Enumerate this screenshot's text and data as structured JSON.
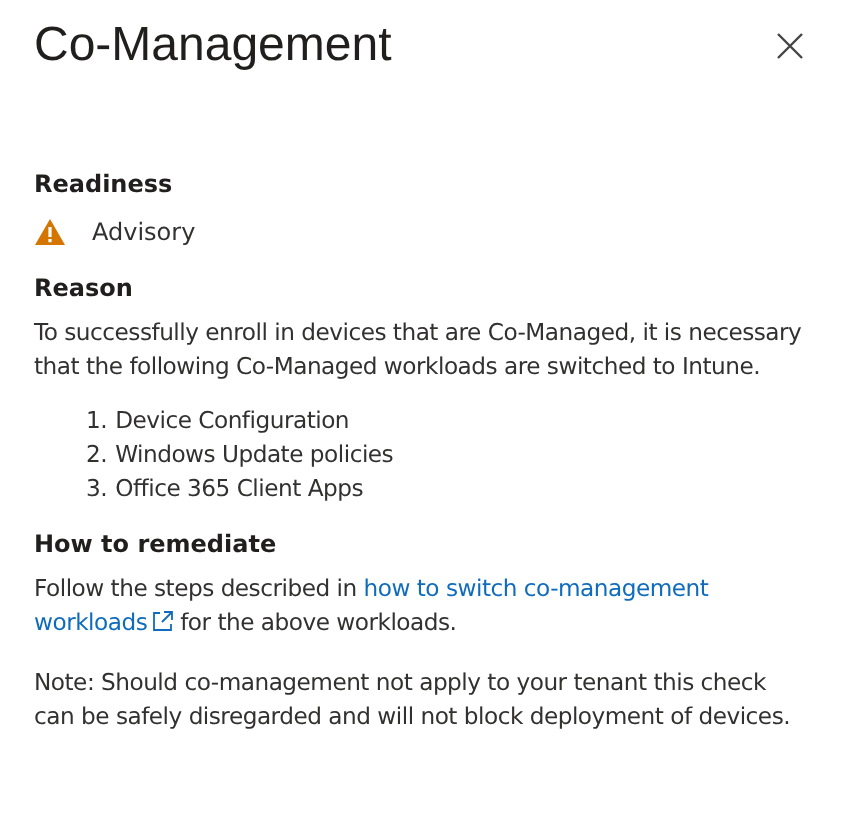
{
  "panel": {
    "title": "Co-Management"
  },
  "readiness": {
    "heading": "Readiness",
    "status": {
      "kind": "warning",
      "label": "Advisory"
    }
  },
  "reason": {
    "heading": "Reason",
    "text": "To successfully enroll in devices that are Co-Managed, it is necessary that the following Co-Managed workloads are switched to Intune.",
    "items": [
      {
        "number": "1.",
        "text": "Device Configuration"
      },
      {
        "number": "2.",
        "text": "Windows Update policies"
      },
      {
        "number": "3.",
        "text": "Office 365 Client Apps"
      }
    ]
  },
  "remediation": {
    "heading": "How to remediate",
    "text_before": "Follow the steps described in",
    "link_lines": [
      "how to switch co-management",
      "workloads"
    ],
    "text_after": "for the above workloads.",
    "note": "Note: Should co-management not apply to your tenant this check can be safely disregarded and will not block deployment of devices."
  }
}
